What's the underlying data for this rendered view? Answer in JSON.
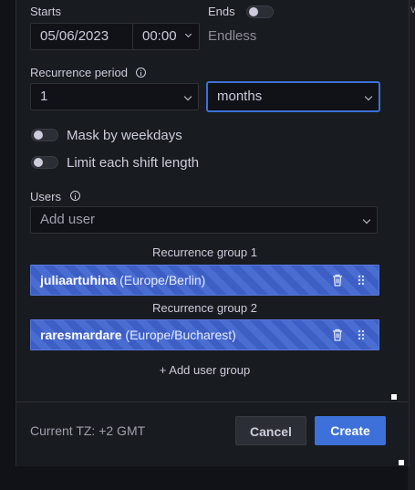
{
  "schedule": {
    "starts_label": "Starts",
    "ends_label": "Ends",
    "start_date": "05/06/2023",
    "start_time": "00:00",
    "endless_text": "Endless"
  },
  "recurrence": {
    "label": "Recurrence period",
    "count": "1",
    "unit": "months"
  },
  "options": {
    "mask_weekdays": "Mask by weekdays",
    "limit_shift": "Limit each shift length"
  },
  "users": {
    "label": "Users",
    "add_placeholder": "Add user",
    "groups": [
      {
        "title": "Recurrence group 1",
        "user": "juliaartuhina",
        "tz": "(Europe/Berlin)"
      },
      {
        "title": "Recurrence group 2",
        "user": "raresmardare",
        "tz": "(Europe/Bucharest)"
      }
    ],
    "add_group": "+ Add user group"
  },
  "footer": {
    "current_tz": "Current TZ: +2 GMT",
    "cancel": "Cancel",
    "create": "Create"
  },
  "colors": {
    "accent": "#3d71d9",
    "user_bar": "#3d5ec4",
    "panel_bg": "#181b1f"
  }
}
